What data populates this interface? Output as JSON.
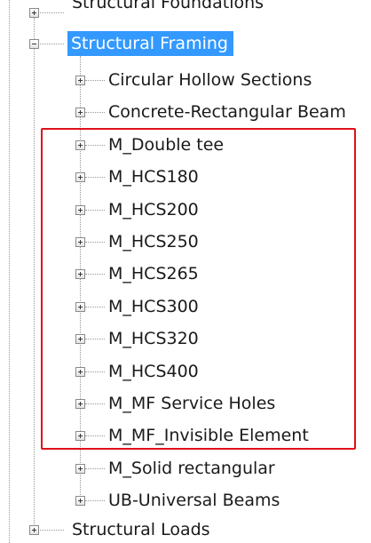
{
  "tree": {
    "top_partial": {
      "label": "Structural Foundations",
      "expanded": false
    },
    "structural_framing": {
      "label": "Structural Framing",
      "expanded": true,
      "selected": true,
      "children": [
        {
          "label": "Circular Hollow Sections",
          "expanded": false
        },
        {
          "label": "Concrete-Rectangular Beam",
          "expanded": false
        },
        {
          "label": "M_Double tee",
          "expanded": false
        },
        {
          "label": "M_HCS180",
          "expanded": false
        },
        {
          "label": "M_HCS200",
          "expanded": false
        },
        {
          "label": "M_HCS250",
          "expanded": false
        },
        {
          "label": "M_HCS265",
          "expanded": false
        },
        {
          "label": "M_HCS300",
          "expanded": false
        },
        {
          "label": "M_HCS320",
          "expanded": false
        },
        {
          "label": "M_HCS400",
          "expanded": false
        },
        {
          "label": "M_MF Service Holes",
          "expanded": false
        },
        {
          "label": "M_MF_Invisible Element",
          "expanded": false
        },
        {
          "label": "M_Solid rectangular",
          "expanded": false
        },
        {
          "label": "UB-Universal Beams",
          "expanded": false
        }
      ]
    },
    "structural_loads": {
      "label": "Structural Loads",
      "expanded": false
    }
  },
  "colors": {
    "selection": "#3399ff",
    "highlight_box": "#e0101a",
    "connector": "#9a9a9a"
  },
  "icons": {
    "expand": "plus-box-icon",
    "collapse": "minus-box-icon"
  }
}
